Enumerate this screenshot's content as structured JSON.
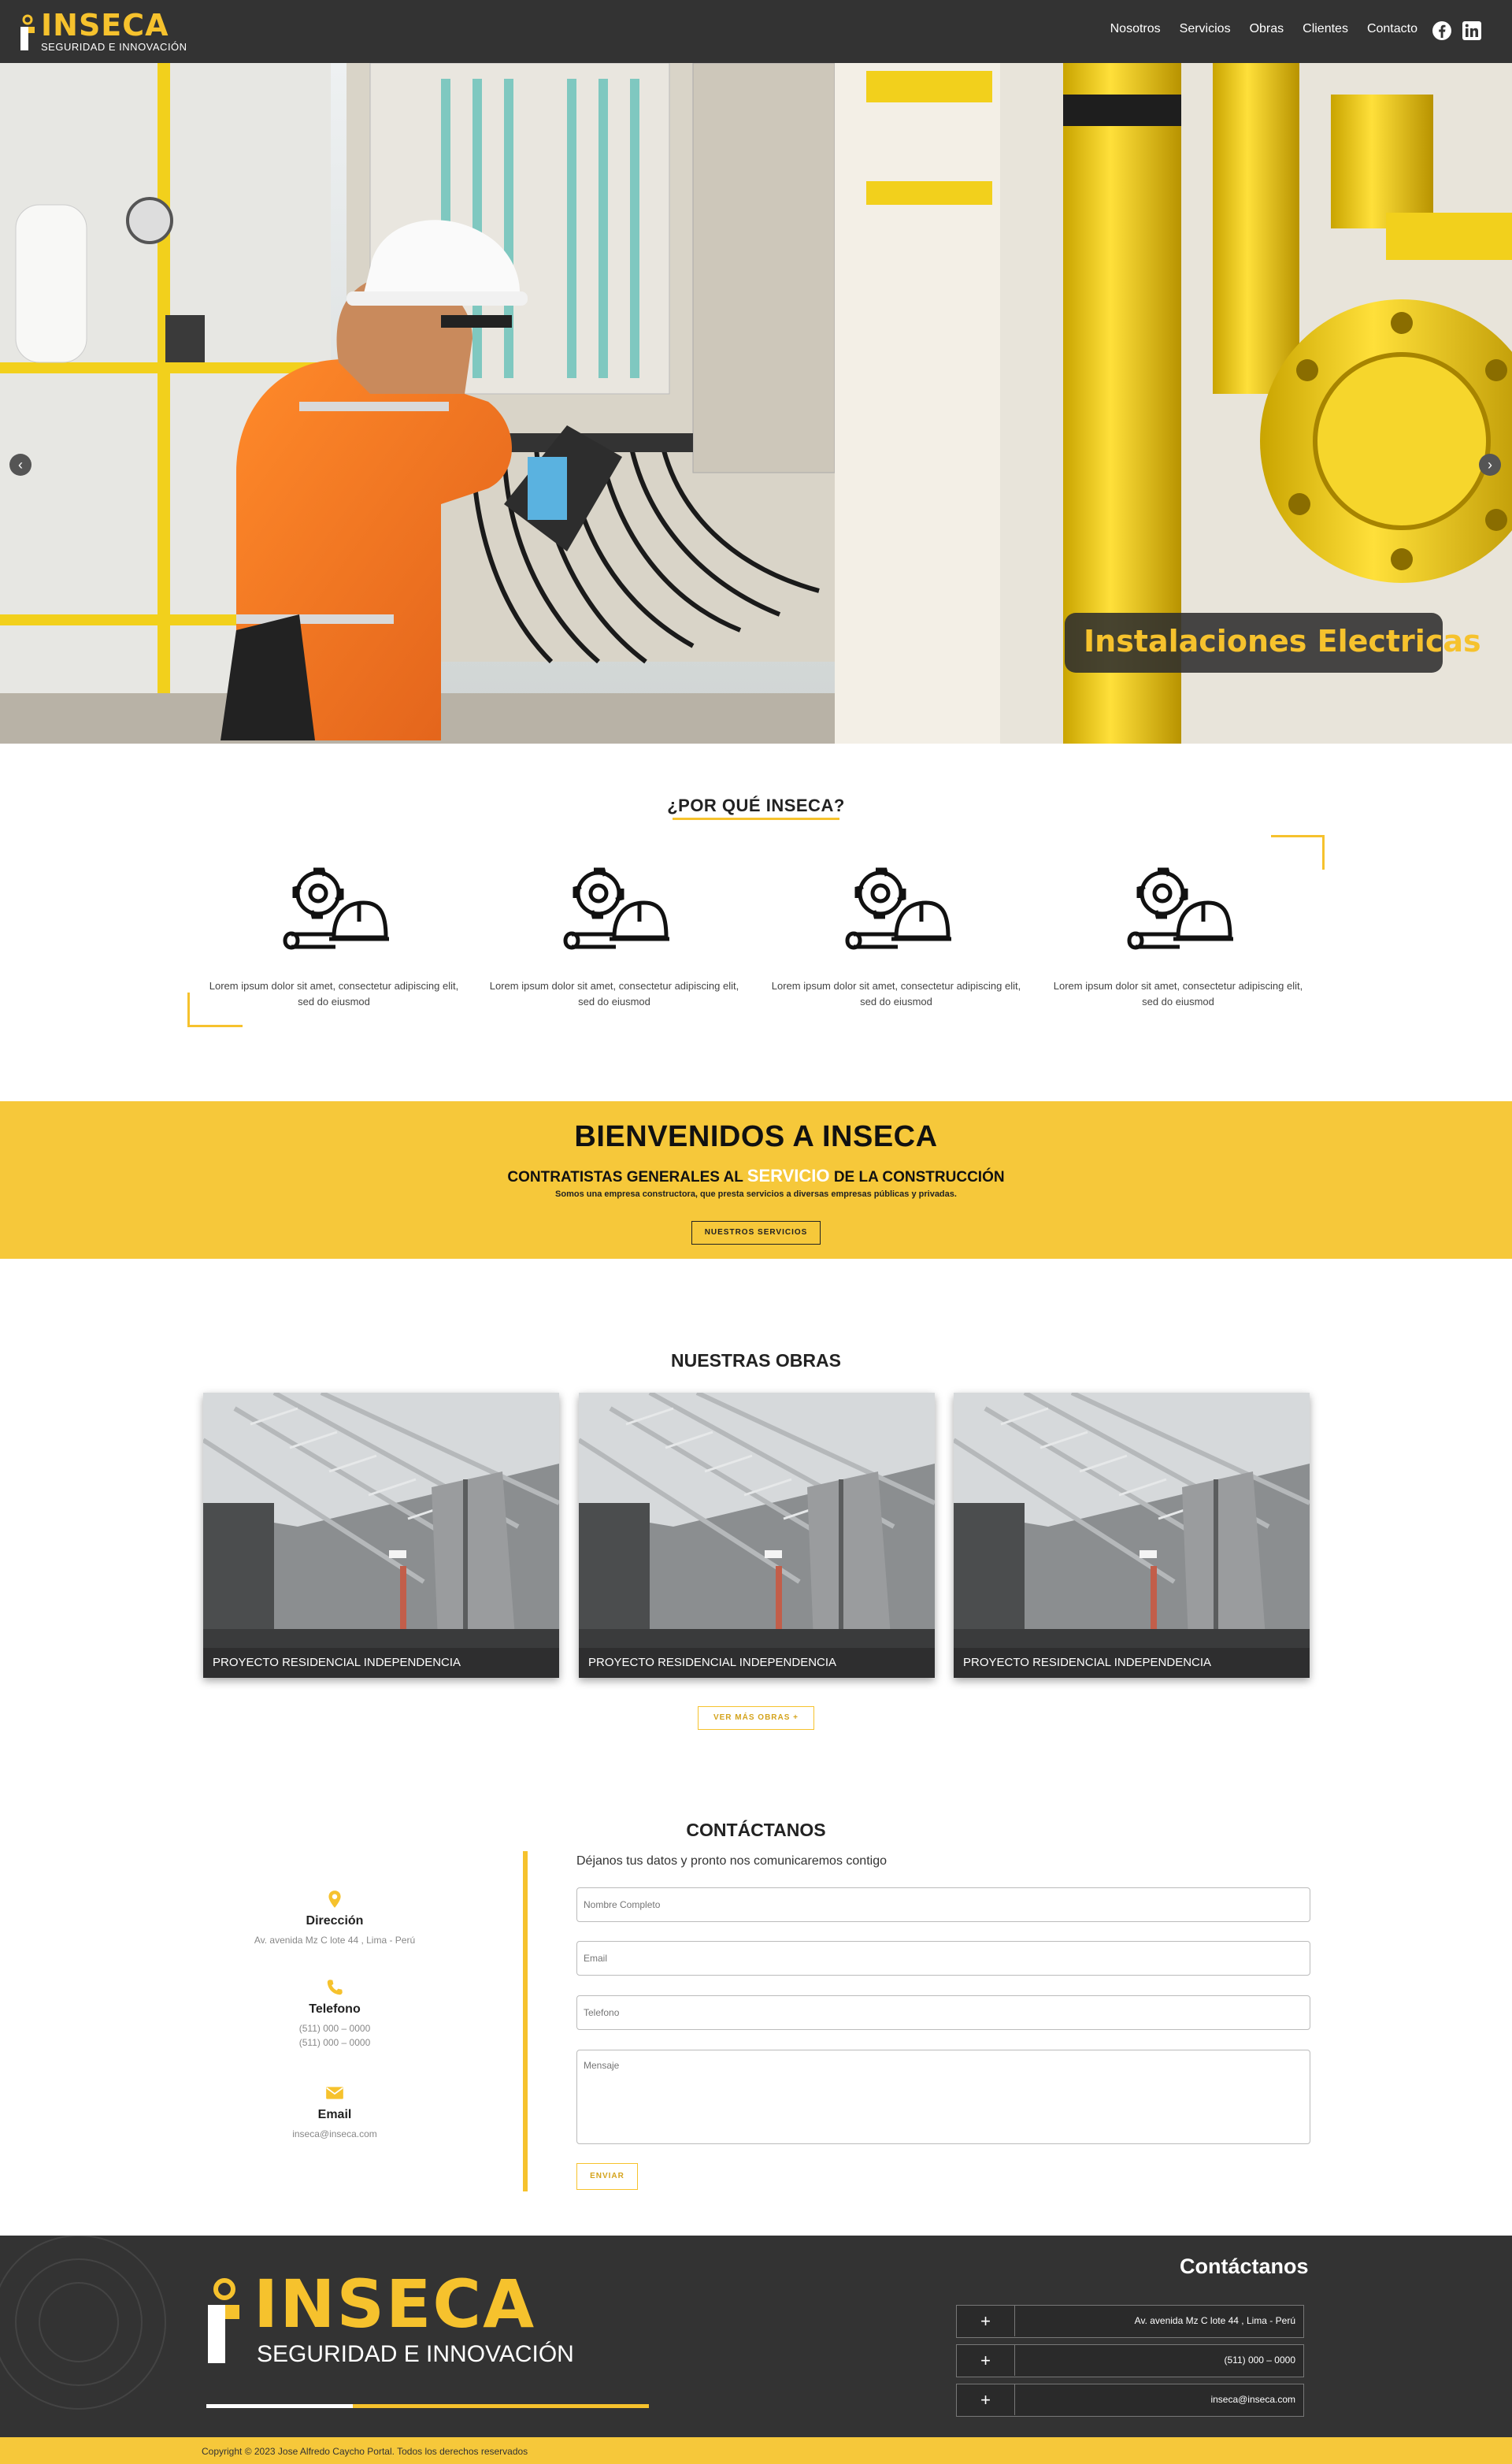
{
  "brand": {
    "logo_text": "INSECA",
    "logo_tagline": "SEGURIDAD E INNOVACIÓN",
    "accent_color": "#f6c22d",
    "dark_color": "#333333"
  },
  "nav": {
    "items": [
      {
        "label": "Nosotros"
      },
      {
        "label": "Servicios"
      },
      {
        "label": "Obras"
      },
      {
        "label": "Clientes"
      },
      {
        "label": "Contacto"
      }
    ],
    "social": [
      {
        "icon": "facebook-icon"
      },
      {
        "icon": "linkedin-icon"
      }
    ]
  },
  "hero": {
    "caption": "Instalaciones Electricas",
    "prev_icon": "chevron-left-icon",
    "next_icon": "chevron-right-icon"
  },
  "why": {
    "title": "¿POR QUÉ INSECA?",
    "items": [
      {
        "icon": "gear-helmet-icon",
        "text": "Lorem ipsum dolor sit amet, consectetur adipiscing elit, sed do eiusmod"
      },
      {
        "icon": "gear-helmet-icon",
        "text": "Lorem ipsum dolor sit amet, consectetur adipiscing elit, sed do eiusmod"
      },
      {
        "icon": "gear-helmet-icon",
        "text": "Lorem ipsum dolor sit amet, consectetur adipiscing elit, sed do eiusmod"
      },
      {
        "icon": "gear-helmet-icon",
        "text": "Lorem ipsum dolor sit amet, consectetur adipiscing elit, sed do eiusmod"
      }
    ]
  },
  "welcome": {
    "title": "BIENVENIDOS A INSECA",
    "subtitle_before": "CONTRATISTAS GENERALES AL ",
    "subtitle_highlight": "SERVICIO",
    "subtitle_after": " DE LA CONSTRUCCIÓN",
    "description": "Somos una empresa constructora, que presta servicios a diversas empresas públicas y privadas.",
    "button": "NUESTROS SERVICIOS"
  },
  "obras": {
    "title": "NUESTRAS OBRAS",
    "cards": [
      {
        "caption": "PROYECTO RESIDENCIAL INDEPENDENCIA"
      },
      {
        "caption": "PROYECTO RESIDENCIAL INDEPENDENCIA"
      },
      {
        "caption": "PROYECTO RESIDENCIAL INDEPENDENCIA"
      }
    ],
    "button": "VER MÁS OBRAS +"
  },
  "contact": {
    "title": "CONTÁCTANOS",
    "lead": "Déjanos tus datos y pronto nos comunicaremos contigo",
    "info": [
      {
        "icon": "location-pin-icon",
        "label": "Dirección",
        "values": [
          "Av. avenida Mz C lote 44 , Lima - Perú"
        ]
      },
      {
        "icon": "phone-icon",
        "label": "Telefono",
        "values": [
          "(511) 000 – 0000",
          "(511) 000 – 0000"
        ]
      },
      {
        "icon": "envelope-icon",
        "label": "Email",
        "values": [
          "inseca@inseca.com"
        ]
      }
    ],
    "fields": {
      "name_placeholder": "Nombre Completo",
      "email_placeholder": "Email",
      "phone_placeholder": "Telefono",
      "message_placeholder": "Mensaje"
    },
    "submit": "ENVIAR"
  },
  "footer": {
    "heading": "Contáctanos",
    "rows": [
      {
        "plus": "+",
        "value": "Av. avenida Mz C lote 44 , Lima - Perú"
      },
      {
        "plus": "+",
        "value": "(511) 000 – 0000"
      },
      {
        "plus": "+",
        "value": "inseca@inseca.com"
      }
    ],
    "copyright": "Copyright © 2023 Jose Alfredo Caycho Portal. Todos los derechos reservados"
  }
}
